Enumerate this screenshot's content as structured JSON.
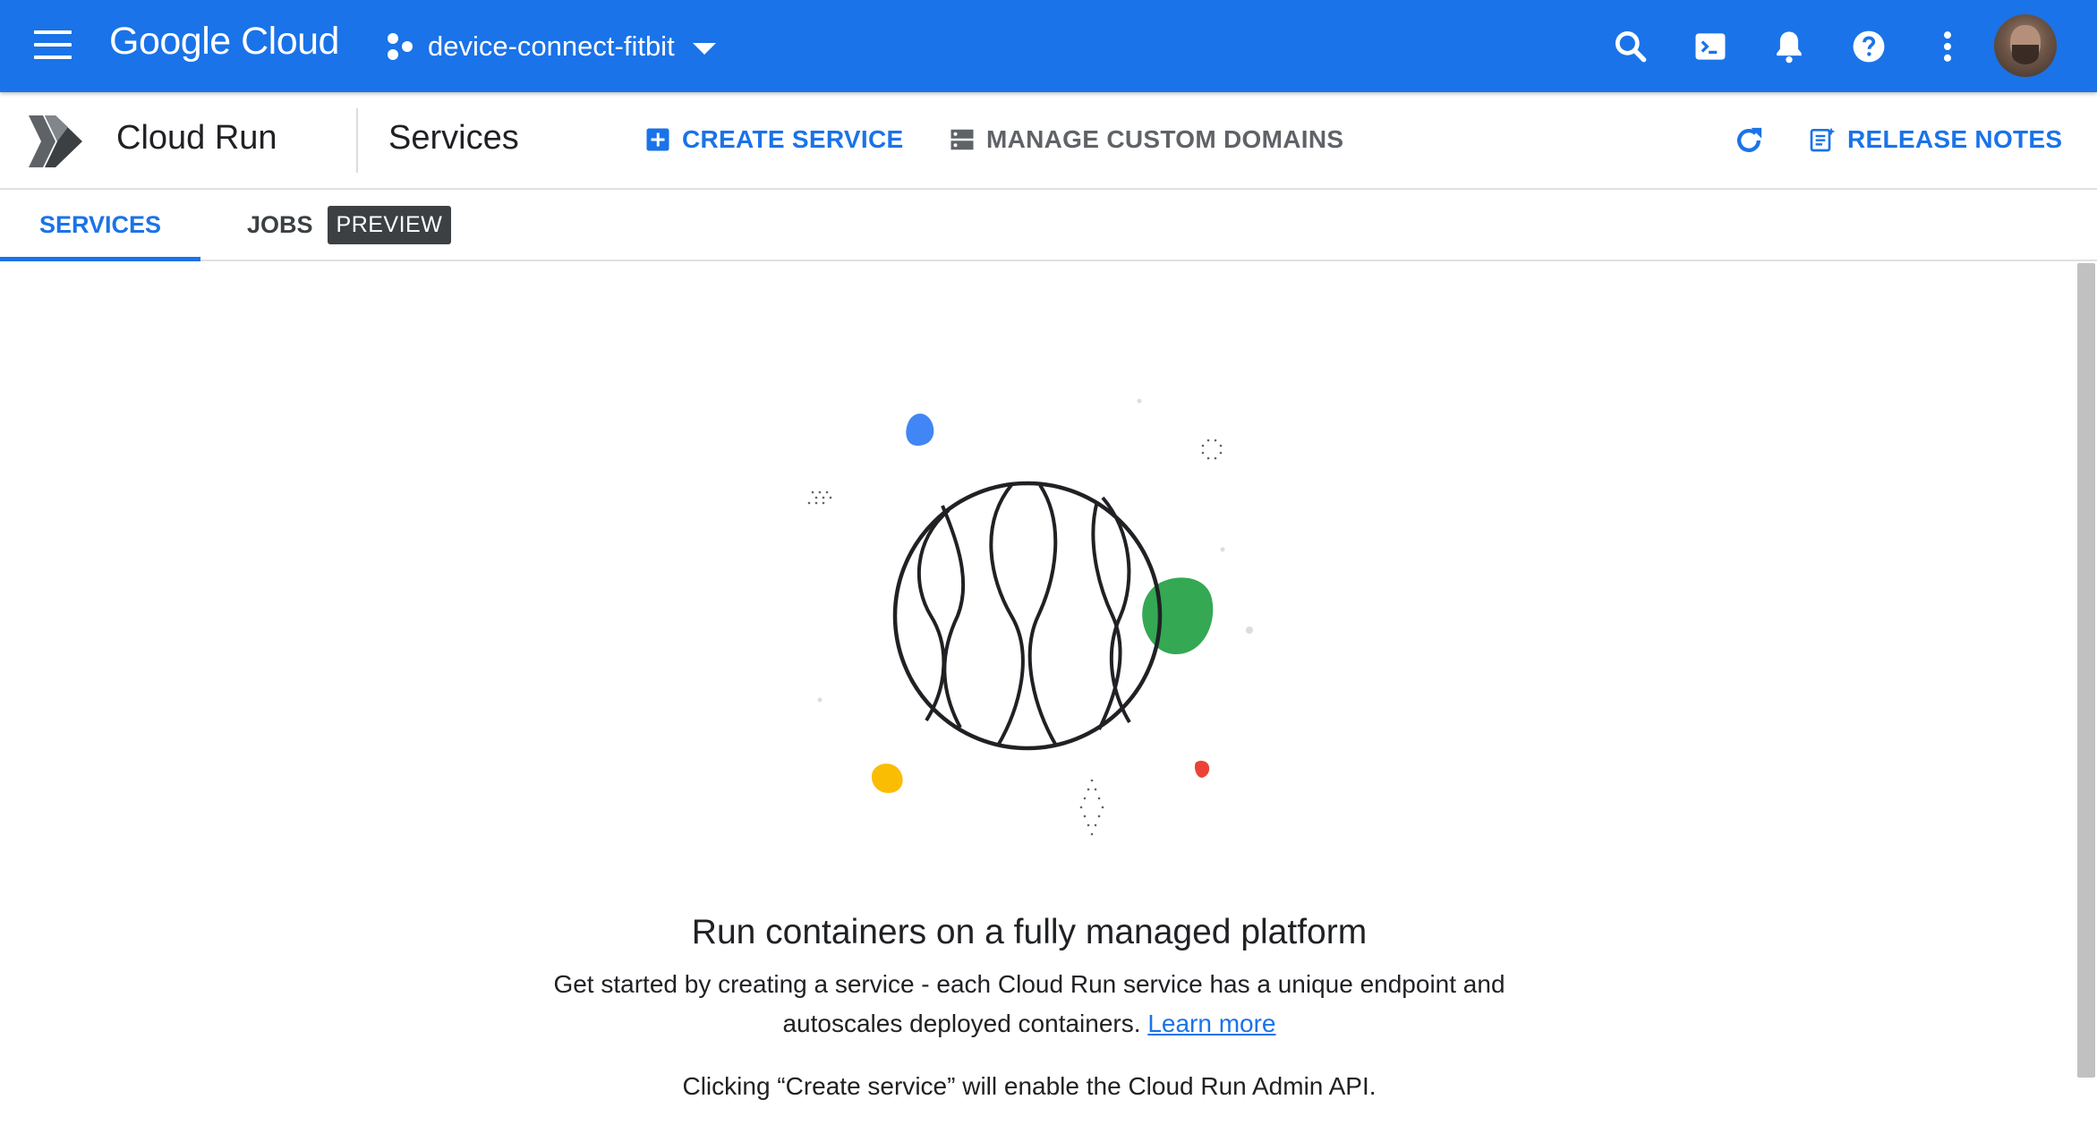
{
  "topbar": {
    "logo": "Google Cloud",
    "project": "device-connect-fitbit",
    "icons": [
      "menu-icon",
      "search-icon",
      "terminal-icon",
      "bell-icon",
      "help-icon",
      "more-vert-icon"
    ],
    "color": "#1a73e8"
  },
  "toolbar": {
    "product": "Cloud Run",
    "page_title": "Services",
    "create_service": "CREATE SERVICE",
    "manage_domains": "MANAGE CUSTOM DOMAINS",
    "release_notes": "RELEASE NOTES"
  },
  "tabs": {
    "services": "SERVICES",
    "jobs": "JOBS",
    "jobs_badge": "PREVIEW"
  },
  "main": {
    "headline": "Run containers on a fully managed platform",
    "desc_part": "Get started by creating a service - each Cloud Run service has a unique endpoint and autoscales deployed containers.",
    "learn_more": "Learn more",
    "note": "Clicking “Create service” will enable the Cloud Run Admin API."
  },
  "colors": {
    "accent": "#1a73e8",
    "blob_blue": "#4285f4",
    "blob_green": "#34a853",
    "blob_yellow": "#fbbc04",
    "blob_red": "#ea4335"
  }
}
